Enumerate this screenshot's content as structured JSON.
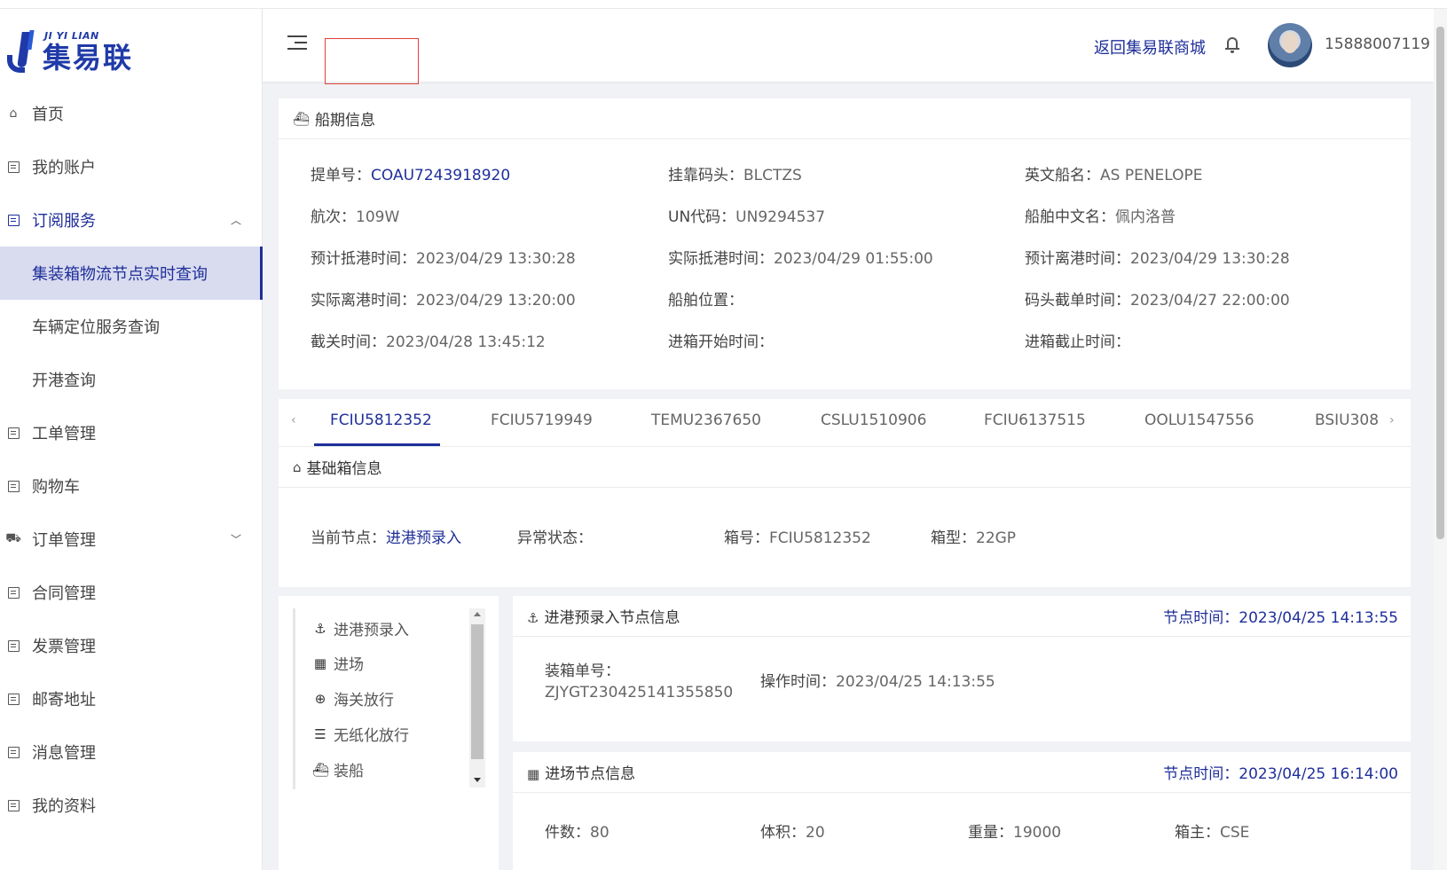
{
  "logo": {
    "en": "JI YI LIAN",
    "cn": "集易联"
  },
  "sidebar": {
    "items": [
      {
        "label": "首页"
      },
      {
        "label": "我的账户"
      },
      {
        "label": "订阅服务"
      },
      {
        "label": "工单管理"
      },
      {
        "label": "购物车"
      },
      {
        "label": "订单管理"
      },
      {
        "label": "合同管理"
      },
      {
        "label": "发票管理"
      },
      {
        "label": "邮寄地址"
      },
      {
        "label": "消息管理"
      },
      {
        "label": "我的资料"
      }
    ],
    "subscription_sub": [
      {
        "label": "集装箱物流节点实时查询"
      },
      {
        "label": "车辆定位服务查询"
      },
      {
        "label": "开港查询"
      }
    ]
  },
  "header": {
    "back_link": "返回集易联商城",
    "phone": "15888007119"
  },
  "ship_info": {
    "title": "船期信息",
    "rows": [
      [
        {
          "label": "提单号：",
          "value": "COAU7243918920",
          "link": true
        },
        {
          "label": "挂靠码头：",
          "value": "BLCTZS"
        },
        {
          "label": "英文船名：",
          "value": "AS PENELOPE"
        }
      ],
      [
        {
          "label": "航次：",
          "value": "109W"
        },
        {
          "label": "UN代码：",
          "value": "UN9294537"
        },
        {
          "label": "船舶中文名：",
          "value": "佩内洛普"
        }
      ],
      [
        {
          "label": "预计抵港时间：",
          "value": "2023/04/29 13:30:28"
        },
        {
          "label": "实际抵港时间：",
          "value": "2023/04/29 01:55:00"
        },
        {
          "label": "预计离港时间：",
          "value": "2023/04/29 13:30:28"
        }
      ],
      [
        {
          "label": "实际离港时间：",
          "value": "2023/04/29 13:20:00"
        },
        {
          "label": "船舶位置：",
          "value": ""
        },
        {
          "label": "码头截单时间：",
          "value": "2023/04/27 22:00:00"
        }
      ],
      [
        {
          "label": "截关时间：",
          "value": "2023/04/28 13:45:12"
        },
        {
          "label": "进箱开始时间：",
          "value": ""
        },
        {
          "label": "进箱截止时间：",
          "value": ""
        }
      ]
    ]
  },
  "container_tabs": [
    "FCIU5812352",
    "FCIU5719949",
    "TEMU2367650",
    "CSLU1510906",
    "FCIU6137515",
    "OOLU1547556",
    "BSIU308"
  ],
  "base_info": {
    "title": "基础箱信息",
    "current_node_label": "当前节点：",
    "current_node_value": "进港预录入",
    "abnormal_label": "异常状态：",
    "abnormal_value": "",
    "box_no_label": "箱号：",
    "box_no_value": "FCIU5812352",
    "box_type_label": "箱型：",
    "box_type_value": "22GP"
  },
  "timeline": [
    "进港预录入",
    "进场",
    "海关放行",
    "无纸化放行",
    "装船"
  ],
  "node1": {
    "title": "进港预录入节点信息",
    "time_label": "节点时间：",
    "time_value": "2023/04/25 14:13:55",
    "packing_label": "装箱单号：",
    "packing_value": "ZJYGT230425141355850",
    "op_label": "操作时间：",
    "op_value": "2023/04/25 14:13:55"
  },
  "node2": {
    "title": "进场节点信息",
    "time_label": "节点时间：",
    "time_value": "2023/04/25 16:14:00",
    "pieces_label": "件数：",
    "pieces_value": "80",
    "volume_label": "体积：",
    "volume_value": "20",
    "weight_label": "重量：",
    "weight_value": "19000",
    "owner_label": "箱主：",
    "owner_value": "CSE"
  },
  "colors": {
    "primary": "#1f2f9a",
    "active_bg": "#d9dcef",
    "alert_box": "#e0403a"
  }
}
